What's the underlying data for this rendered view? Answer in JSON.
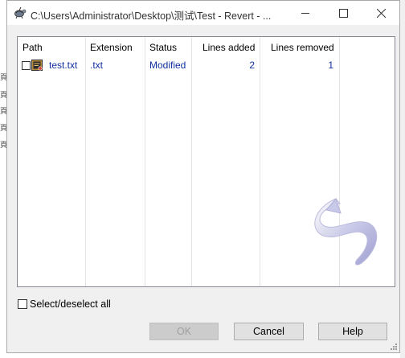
{
  "window": {
    "title": "C:\\Users\\Administrator\\Desktop\\测试\\Test - Revert - ...",
    "icons": {
      "app": "tortoise-icon",
      "minimize": "minimize-icon",
      "maximize": "maximize-icon",
      "close": "close-icon"
    }
  },
  "list": {
    "columns": [
      "Path",
      "Extension",
      "Status",
      "Lines added",
      "Lines removed"
    ],
    "rows": [
      {
        "checked": false,
        "path": "test.txt",
        "extension": ".txt",
        "status": "Modified",
        "lines_added": "2",
        "lines_removed": "1",
        "icon": "text-file-icon"
      }
    ],
    "text_color": "#1030a0",
    "watermark_icon": "revert-arrow-icon"
  },
  "select_all": {
    "label": "Select/deselect all",
    "checked": false
  },
  "buttons": {
    "ok": "OK",
    "cancel": "Cancel",
    "help": "Help"
  },
  "background": {
    "left_marks": [
      "頁",
      "頁",
      "頁",
      "頁",
      "頁"
    ]
  }
}
